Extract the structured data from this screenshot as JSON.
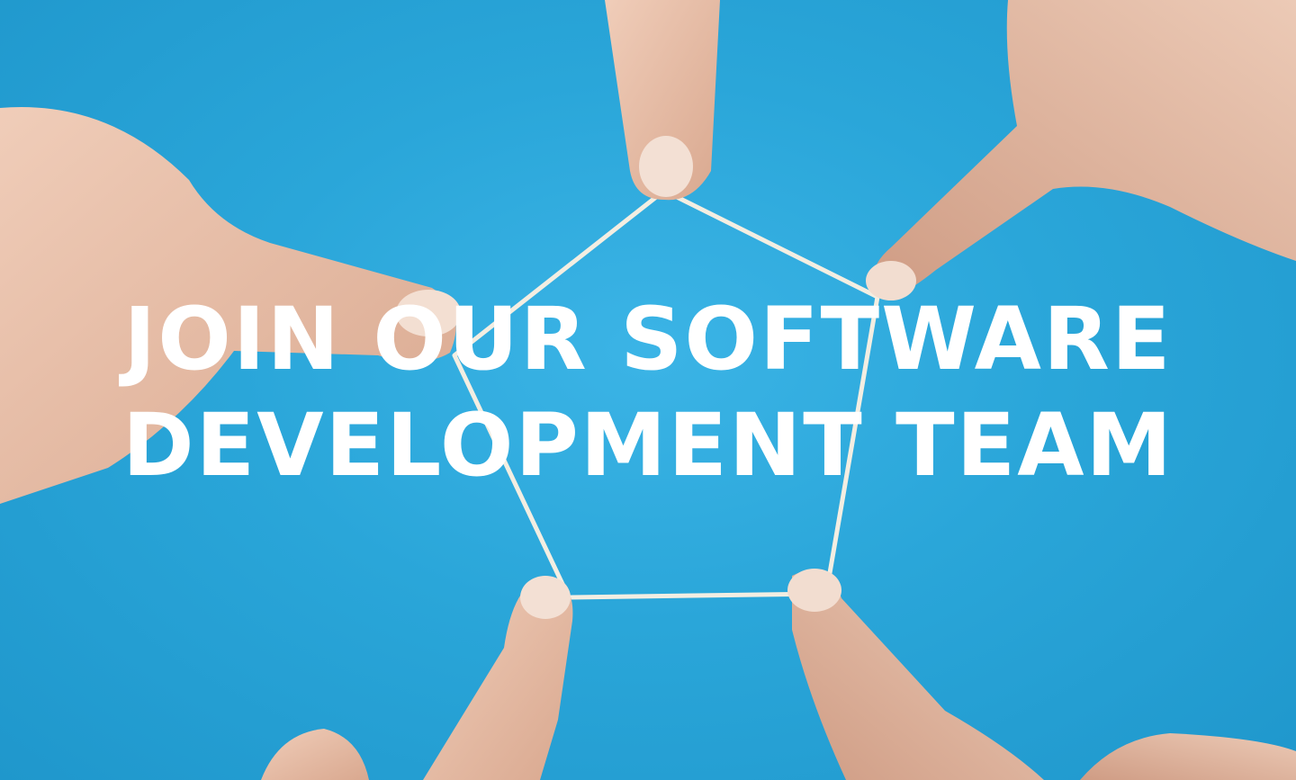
{
  "hero": {
    "headline_line1": "JOIN OUR SOFTWARE",
    "headline_line2": "DEVELOPMENT TEAM"
  },
  "colors": {
    "background": "#2aa6d9",
    "skin": "#e9c3ae",
    "rubber_band": "#f3eee2",
    "text": "#ffffff"
  }
}
